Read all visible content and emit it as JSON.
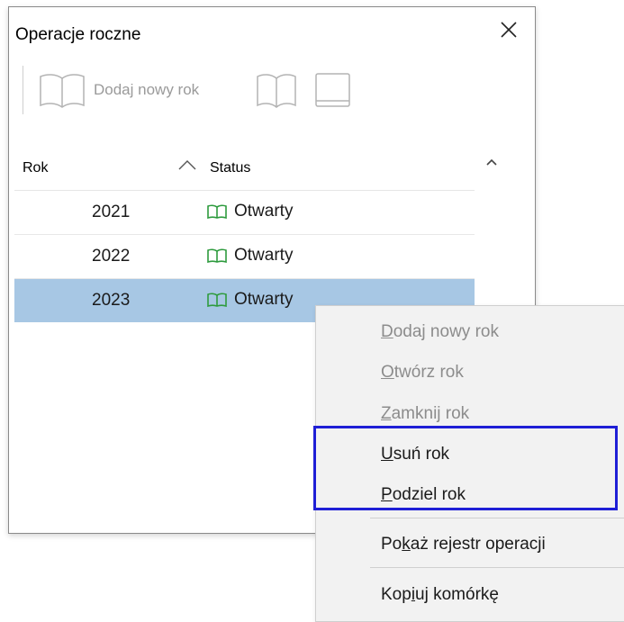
{
  "window": {
    "title": "Operacje roczne"
  },
  "toolbar": {
    "add_label": "Dodaj nowy rok",
    "add_icon": "book-icon",
    "open_icon": "book-open-icon",
    "close_icon": "book-closed-icon",
    "disabled_color": "#9a9a9a"
  },
  "grid": {
    "columns": [
      "Rok",
      "Status"
    ],
    "sort_column": "Rok",
    "sort_direction": "ascending",
    "rows": [
      {
        "year": "2021",
        "status": "Otwarty",
        "selected": false
      },
      {
        "year": "2022",
        "status": "Otwarty",
        "selected": false
      },
      {
        "year": "2023",
        "status": "Otwarty",
        "selected": true
      }
    ],
    "selection_color": "#a7c7e4",
    "status_icon_color": "#2e9b3e"
  },
  "context_menu": {
    "items": [
      {
        "pre": "",
        "key": "D",
        "post": "odaj nowy rok",
        "enabled": false
      },
      {
        "pre": "",
        "key": "O",
        "post": "twórz rok",
        "enabled": false
      },
      {
        "pre": "",
        "key": "Z",
        "post": "amknij rok",
        "enabled": false
      },
      {
        "pre": "",
        "key": "U",
        "post": "suń rok",
        "enabled": true
      },
      {
        "pre": "",
        "key": "P",
        "post": "odziel rok",
        "enabled": true
      },
      {
        "pre": "Po",
        "key": "k",
        "post": "aż rejestr operacji",
        "enabled": true
      },
      {
        "pre": "Kop",
        "key": "i",
        "post": "uj komórkę",
        "enabled": true
      }
    ],
    "highlight_color": "#1f1fd6"
  }
}
